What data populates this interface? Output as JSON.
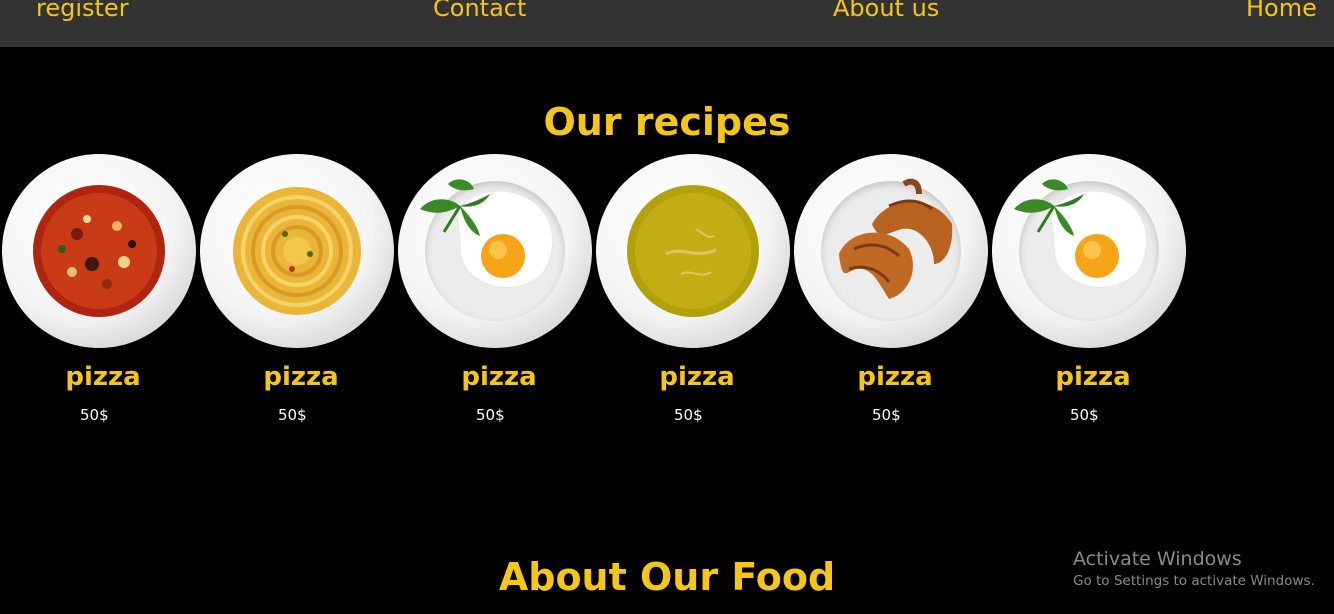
{
  "nav": {
    "register": "register",
    "contact": "Contact",
    "about": "About us",
    "home": "Home"
  },
  "recipes": {
    "title": "Our recipes",
    "items": [
      {
        "name": "pizza",
        "price": "50$",
        "dish": "tomato-soup"
      },
      {
        "name": "pizza",
        "price": "50$",
        "dish": "spaghetti"
      },
      {
        "name": "pizza",
        "price": "50$",
        "dish": "fried-egg"
      },
      {
        "name": "pizza",
        "price": "50$",
        "dish": "pea-soup"
      },
      {
        "name": "pizza",
        "price": "50$",
        "dish": "croissants"
      },
      {
        "name": "pizza",
        "price": "50$",
        "dish": "fried-egg"
      }
    ]
  },
  "about": {
    "title": "About Our Food"
  },
  "watermark": {
    "title": "Activate Windows",
    "subtitle": "Go to Settings to activate Windows."
  },
  "colors": {
    "accent": "#f5c518",
    "nav_bg": "#333333",
    "page_bg": "#000000"
  }
}
